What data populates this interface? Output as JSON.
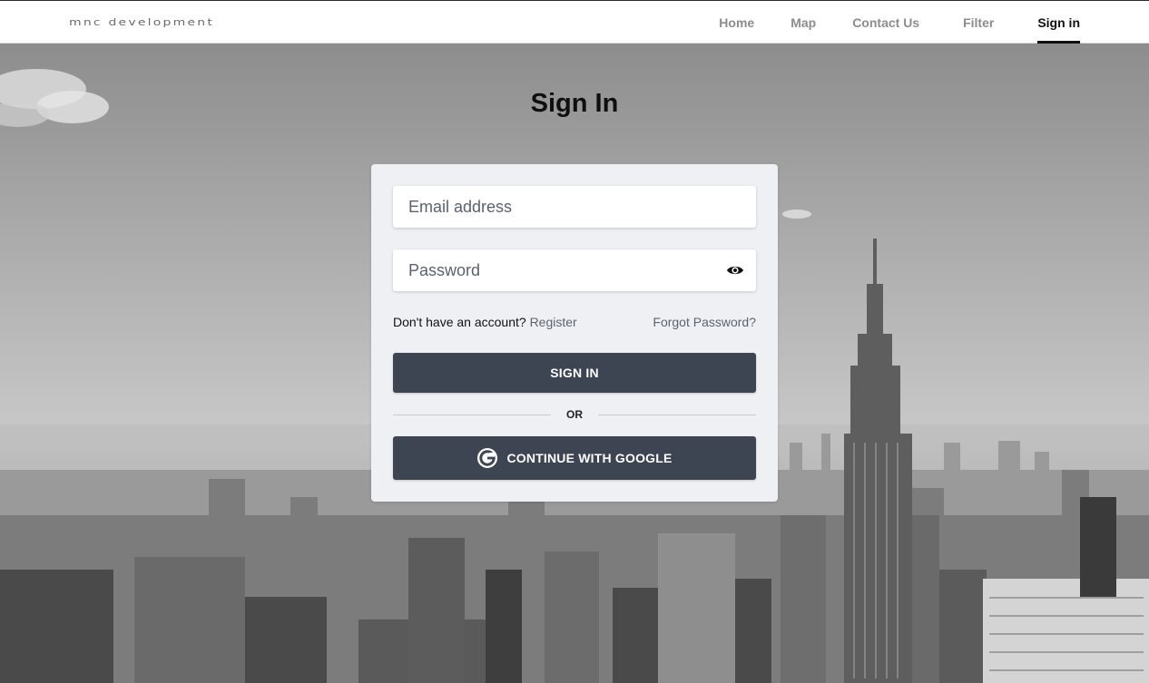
{
  "brand": {
    "logo_text": "mnc development"
  },
  "nav": {
    "items": [
      {
        "label": "Home",
        "active": false
      },
      {
        "label": "Map",
        "active": false
      },
      {
        "label": "Contact Us",
        "active": false
      },
      {
        "label": "Filter",
        "active": false
      },
      {
        "label": "Sign in",
        "active": true
      }
    ]
  },
  "page": {
    "title": "Sign In"
  },
  "form": {
    "email_placeholder": "Email address",
    "email_value": "",
    "password_placeholder": "Password",
    "password_value": "",
    "password_toggle_icon": "eye-icon",
    "no_account_text": "Don't have an account?",
    "register_label": "Register",
    "forgot_label": "Forgot Password?",
    "signin_label": "SIGN IN",
    "divider_label": "OR",
    "google_label": "CONTINUE WITH GOOGLE",
    "google_icon": "google-icon"
  },
  "colors": {
    "button_bg": "#3d4452",
    "card_bg": "#eff0f4",
    "link_gray": "#5d6470",
    "active_nav": "#111111",
    "inactive_nav": "#8c8c8c"
  }
}
